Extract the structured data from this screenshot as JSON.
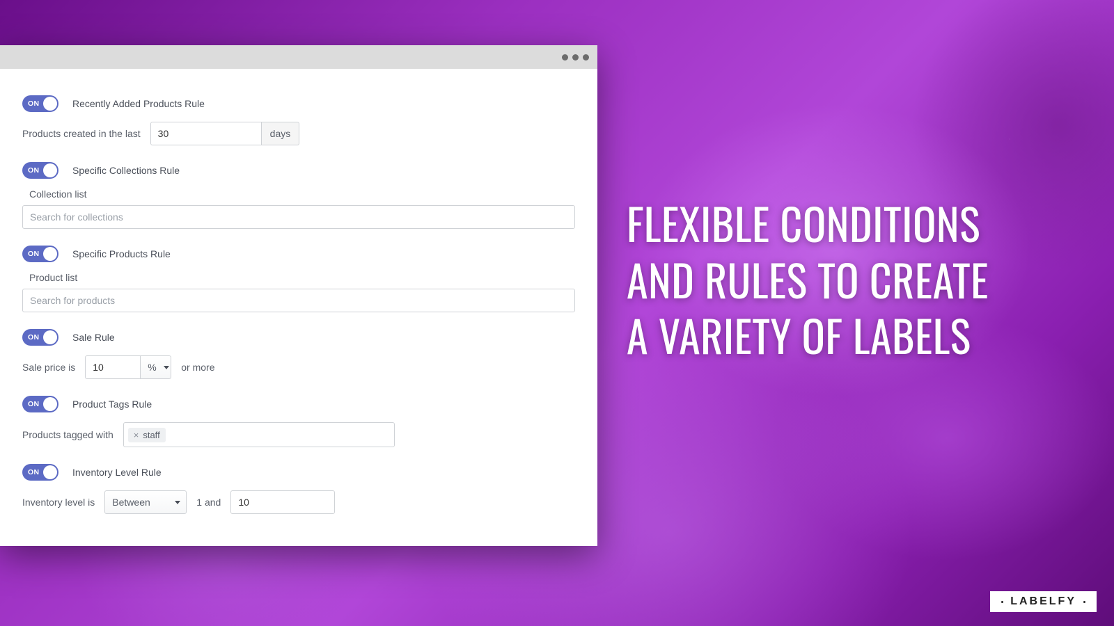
{
  "promo_text": "Flexible conditions and rules to create a variety of labels",
  "brand": "LABELFY",
  "toggle_label": "ON",
  "rules": {
    "recent": {
      "title": "Recently Added Products Rule",
      "prefix": "Products created in the last",
      "value": "30",
      "unit": "days"
    },
    "collections": {
      "title": "Specific Collections Rule",
      "sublabel": "Collection list",
      "placeholder": "Search for collections"
    },
    "products": {
      "title": "Specific Products Rule",
      "sublabel": "Product list",
      "placeholder": "Search for products"
    },
    "sale": {
      "title": "Sale Rule",
      "prefix": "Sale price is",
      "value": "10",
      "unit": "%",
      "suffix": "or more"
    },
    "tags": {
      "title": "Product Tags Rule",
      "prefix": "Products tagged with",
      "tag": "staff"
    },
    "inventory": {
      "title": "Inventory Level Rule",
      "prefix": "Inventory level is",
      "operator": "Between",
      "middle": "1 and",
      "value": "10"
    }
  }
}
